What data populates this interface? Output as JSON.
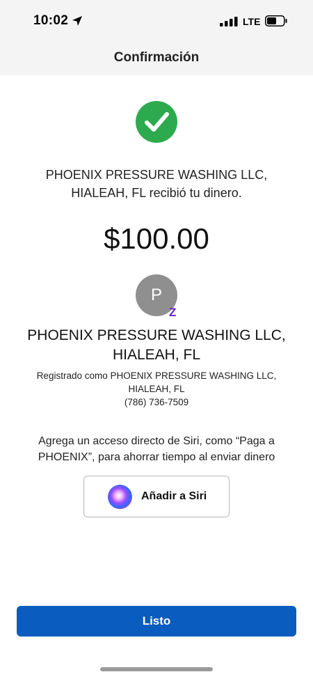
{
  "status_bar": {
    "time": "10:02",
    "network": "LTE",
    "icons": [
      "location-arrow-icon",
      "signal-bars-icon",
      "battery-icon"
    ]
  },
  "header": {
    "title": "Confirmación"
  },
  "confirmation": {
    "icon": "checkmark-circle-icon",
    "message": "PHOENIX PRESSURE WASHING LLC, HIALEAH, FL recibió tu dinero.",
    "amount": "$100.00"
  },
  "recipient": {
    "avatar_initial": "P",
    "badge": "Z",
    "name": "PHOENIX PRESSURE WASHING LLC, HIALEAH, FL",
    "registered_as": "Registrado como PHOENIX PRESSURE WASHING LLC, HIALEAH, FL",
    "phone": "(786) 736-7509"
  },
  "siri": {
    "description": "Agrega un acceso directo de Siri, como “Paga a PHOENIX”, para ahorrar tiempo al enviar dinero",
    "button_label": "Añadir a Siri"
  },
  "footer": {
    "done_label": "Listo"
  },
  "colors": {
    "success": "#2eaa4e",
    "primary": "#0a5cbe",
    "zelle": "#6d1ed4",
    "avatar": "#8f8f8f",
    "header_bg": "#f4f4f5"
  }
}
